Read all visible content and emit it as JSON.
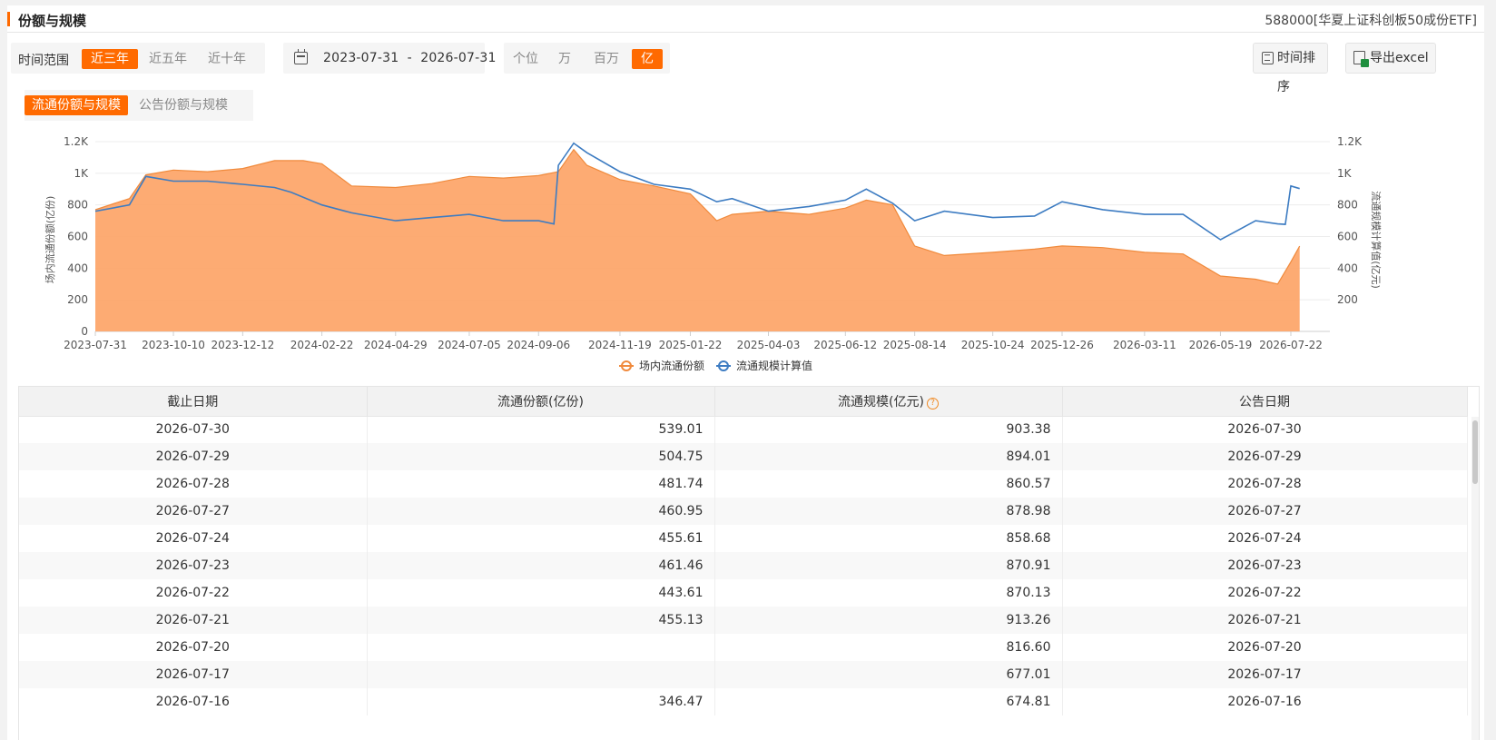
{
  "header": {
    "title": "份额与规模",
    "fund": "588000[华夏上证科创板50成份ETF]"
  },
  "range": {
    "label": "时间范围",
    "options": [
      "近三年",
      "近五年",
      "近十年"
    ],
    "active": 0,
    "date_text": "2023-07-31  -  2026-07-31"
  },
  "units": {
    "options": [
      "个位",
      "万",
      "百万",
      "亿"
    ],
    "active": 3
  },
  "actions": {
    "sort_label": "时间排序",
    "export_label": "导出excel"
  },
  "tabs": {
    "items": [
      "流通份额与规模",
      "公告份额与规模"
    ],
    "active": 0
  },
  "colors": {
    "accent": "#ff6a00",
    "area_fill": "#fda66b",
    "area_line": "#f08a3c",
    "line": "#3d7cc2"
  },
  "chart_data": {
    "type": "area",
    "x_ticks": [
      "2023-07-31",
      "2023-10-10",
      "2023-12-12",
      "2024-02-22",
      "2024-04-29",
      "2024-07-05",
      "2024-09-06",
      "2024-11-19",
      "2025-01-22",
      "2025-04-03",
      "2025-06-12",
      "2025-08-14",
      "2025-10-24",
      "2025-12-26",
      "2026-03-11",
      "2026-05-19",
      "2026-07-22"
    ],
    "y_left_ticks": [
      "0",
      "200",
      "400",
      "600",
      "800",
      "1K",
      "1.2K"
    ],
    "y_right_ticks": [
      "200",
      "400",
      "600",
      "800",
      "1K",
      "1.2K"
    ],
    "ylabel_left": "场内流通份额(亿份)",
    "ylabel_right": "流通规模计算值(亿元)",
    "ylim": [
      0,
      1200
    ],
    "grid": true,
    "legend_position": "bottom",
    "series": [
      {
        "name": "场内流通份额",
        "kind": "area",
        "x": [
          "2023-07-31",
          "2023-08-31",
          "2023-09-15",
          "2023-10-10",
          "2023-11-10",
          "2023-12-12",
          "2024-01-10",
          "2024-02-05",
          "2024-02-22",
          "2024-03-20",
          "2024-04-29",
          "2024-06-01",
          "2024-07-05",
          "2024-08-05",
          "2024-09-06",
          "2024-09-24",
          "2024-10-08",
          "2024-10-20",
          "2024-11-19",
          "2024-12-20",
          "2025-01-22",
          "2025-02-15",
          "2025-03-01",
          "2025-04-03",
          "2025-05-10",
          "2025-06-12",
          "2025-07-01",
          "2025-07-25",
          "2025-08-14",
          "2025-09-10",
          "2025-10-24",
          "2025-12-01",
          "2025-12-26",
          "2026-02-01",
          "2026-03-11",
          "2026-04-15",
          "2026-05-19",
          "2026-06-20",
          "2026-07-10",
          "2026-07-22",
          "2026-07-30"
        ],
        "values": [
          770,
          840,
          990,
          1020,
          1010,
          1030,
          1080,
          1080,
          1060,
          920,
          910,
          935,
          980,
          970,
          985,
          1010,
          1150,
          1050,
          960,
          920,
          870,
          700,
          740,
          760,
          740,
          780,
          830,
          800,
          540,
          480,
          500,
          520,
          540,
          530,
          500,
          490,
          350,
          330,
          300,
          440,
          539.01
        ]
      },
      {
        "name": "流通规模计算值",
        "kind": "line",
        "x": [
          "2023-07-31",
          "2023-08-31",
          "2023-09-15",
          "2023-10-10",
          "2023-11-10",
          "2023-12-12",
          "2024-01-10",
          "2024-01-25",
          "2024-02-22",
          "2024-03-20",
          "2024-04-29",
          "2024-06-01",
          "2024-07-05",
          "2024-08-05",
          "2024-09-06",
          "2024-09-20",
          "2024-09-24",
          "2024-10-08",
          "2024-10-20",
          "2024-11-19",
          "2024-12-20",
          "2025-01-22",
          "2025-02-15",
          "2025-03-01",
          "2025-04-03",
          "2025-05-10",
          "2025-06-12",
          "2025-07-01",
          "2025-07-25",
          "2025-08-14",
          "2025-09-10",
          "2025-10-24",
          "2025-12-01",
          "2025-12-26",
          "2026-02-01",
          "2026-03-11",
          "2026-04-15",
          "2026-05-19",
          "2026-06-20",
          "2026-07-10",
          "2026-07-17",
          "2026-07-22",
          "2026-07-30"
        ],
        "values": [
          760,
          800,
          980,
          950,
          950,
          930,
          910,
          880,
          800,
          750,
          700,
          720,
          740,
          700,
          700,
          680,
          1050,
          1190,
          1130,
          1010,
          930,
          900,
          820,
          840,
          760,
          790,
          830,
          900,
          810,
          700,
          760,
          720,
          730,
          820,
          770,
          740,
          740,
          580,
          700,
          680,
          677.01,
          920,
          903.38
        ]
      }
    ]
  },
  "table": {
    "columns": [
      "截止日期",
      "流通份额(亿份)",
      "流通规模(亿元)",
      "公告日期"
    ],
    "help_icon": "question-circle-icon",
    "rows": [
      [
        "2026-07-30",
        "539.01",
        "903.38",
        "2026-07-30"
      ],
      [
        "2026-07-29",
        "504.75",
        "894.01",
        "2026-07-29"
      ],
      [
        "2026-07-28",
        "481.74",
        "860.57",
        "2026-07-28"
      ],
      [
        "2026-07-27",
        "460.95",
        "878.98",
        "2026-07-27"
      ],
      [
        "2026-07-24",
        "455.61",
        "858.68",
        "2026-07-24"
      ],
      [
        "2026-07-23",
        "461.46",
        "870.91",
        "2026-07-23"
      ],
      [
        "2026-07-22",
        "443.61",
        "870.13",
        "2026-07-22"
      ],
      [
        "2026-07-21",
        "455.13",
        "913.26",
        "2026-07-21"
      ],
      [
        "2026-07-20",
        "",
        "816.60",
        "2026-07-20"
      ],
      [
        "2026-07-17",
        "",
        "677.01",
        "2026-07-17"
      ],
      [
        "2026-07-16",
        "346.47",
        "674.81",
        "2026-07-16"
      ]
    ]
  }
}
